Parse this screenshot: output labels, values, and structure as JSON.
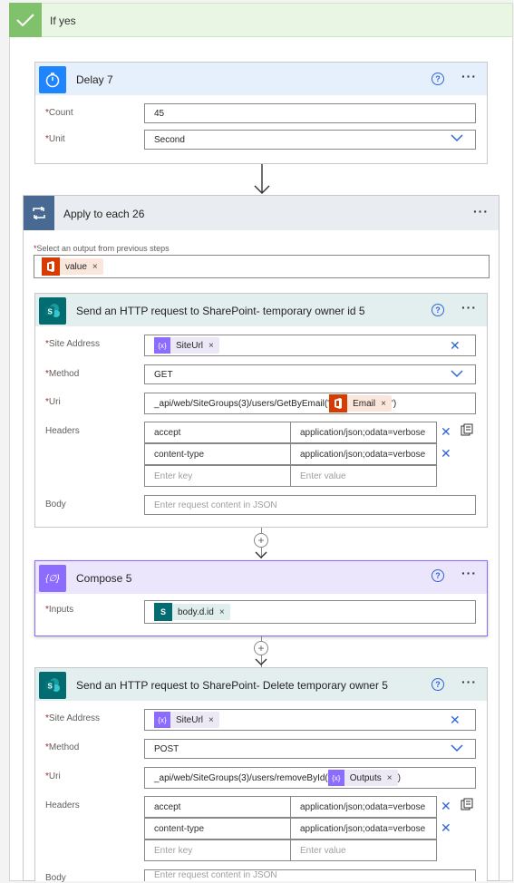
{
  "ifyes": {
    "title": "If yes"
  },
  "delay": {
    "title": "Delay 7",
    "count_label": "Count",
    "count_value": "45",
    "unit_label": "Unit",
    "unit_value": "Second"
  },
  "apply": {
    "title": "Apply to each 26",
    "select_label": "Select an output from previous steps",
    "token": "value"
  },
  "http1": {
    "title": "Send an HTTP request to SharePoint- temporary owner id 5",
    "site_label": "Site Address",
    "site_token": "SiteUrl",
    "method_label": "Method",
    "method_value": "GET",
    "uri_label": "Uri",
    "uri_prefix": "_api/web/SiteGroups(3)/users/GetByEmail('",
    "uri_token": "Email",
    "uri_suffix": "')",
    "headers_label": "Headers",
    "headers": [
      {
        "key": "accept",
        "value": "application/json;odata=verbose"
      },
      {
        "key": "content-type",
        "value": "application/json;odata=verbose"
      }
    ],
    "key_placeholder": "Enter key",
    "value_placeholder": "Enter value",
    "body_label": "Body",
    "body_placeholder": "Enter request content in JSON"
  },
  "compose": {
    "title": "Compose 5",
    "inputs_label": "Inputs",
    "token": "body.d.id"
  },
  "http2": {
    "title": "Send an HTTP request to SharePoint- Delete temporary owner 5",
    "site_label": "Site Address",
    "site_token": "SiteUrl",
    "method_label": "Method",
    "method_value": "POST",
    "uri_label": "Uri",
    "uri_prefix": "_api/web/SiteGroups(3)/users/removeById(",
    "uri_token": "Outputs",
    "uri_suffix": ")",
    "headers_label": "Headers",
    "headers": [
      {
        "key": "accept",
        "value": "application/json;odata=verbose"
      },
      {
        "key": "content-type",
        "value": "application/json;odata=verbose"
      }
    ],
    "key_placeholder": "Enter key",
    "value_placeholder": "Enter value",
    "body_label": "Body",
    "body_placeholder": "Enter request content in JSON"
  },
  "colors": {
    "condition_green": "#7fc26b",
    "delay_blue": "#1f85ff",
    "apply_grey": "#486991",
    "sharepoint_teal": "#036c70",
    "compose_purple": "#8c6cff",
    "office_orange": "#d83b01",
    "link_blue": "#2e66d6"
  },
  "icons": {
    "ifyes": "checkmark-icon",
    "delay": "stopwatch-icon",
    "apply": "loop-icon",
    "sharepoint": "sharepoint-icon",
    "compose": "expression-icon",
    "office": "office-icon"
  }
}
